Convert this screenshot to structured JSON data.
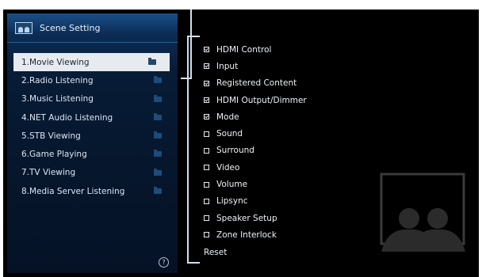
{
  "sidebar": {
    "title": "Scene Setting",
    "items": [
      {
        "label": "1.Movie Viewing",
        "selected": true
      },
      {
        "label": "2.Radio Listening",
        "selected": false
      },
      {
        "label": "3.Music Listening",
        "selected": false
      },
      {
        "label": "4.NET Audio Listening",
        "selected": false
      },
      {
        "label": "5.STB Viewing",
        "selected": false
      },
      {
        "label": "6.Game Playing",
        "selected": false
      },
      {
        "label": "7.TV Viewing",
        "selected": false
      },
      {
        "label": "8.Media Server Listening",
        "selected": false
      }
    ],
    "help_icon": "?"
  },
  "options": {
    "items": [
      {
        "label": "HDMI Control",
        "checked": true
      },
      {
        "label": "Input",
        "checked": true
      },
      {
        "label": "Registered Content",
        "checked": true
      },
      {
        "label": "HDMI Output/Dimmer",
        "checked": true
      },
      {
        "label": "Mode",
        "checked": true
      },
      {
        "label": "Sound",
        "checked": false
      },
      {
        "label": "Surround",
        "checked": false
      },
      {
        "label": "Video",
        "checked": false
      },
      {
        "label": "Volume",
        "checked": false
      },
      {
        "label": "Lipsync",
        "checked": false
      },
      {
        "label": "Speaker Setup",
        "checked": false
      },
      {
        "label": "Zone Interlock",
        "checked": false
      }
    ],
    "reset_label": "Reset"
  },
  "colors": {
    "screen_bg": "#000000",
    "sidebar_top": "#1a4f86",
    "sidebar_bottom": "#051226",
    "selected_bg": "#e7ebef",
    "text": "#eef2f6"
  }
}
